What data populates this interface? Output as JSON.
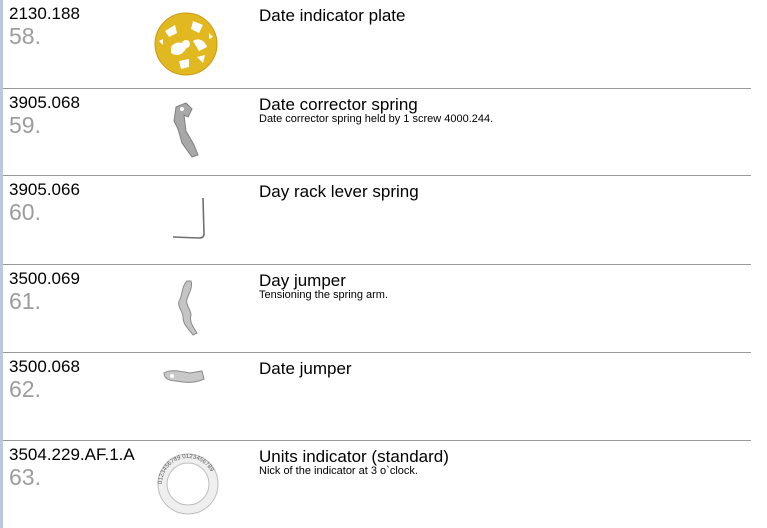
{
  "parts": [
    {
      "code": "2130.188",
      "number": "58.",
      "title": "Date indicator plate",
      "description": "",
      "image": "date-indicator-plate-image"
    },
    {
      "code": "3905.068",
      "number": "59.",
      "title": "Date corrector spring",
      "description": "Date corrector spring held by 1 screw 4000.244.",
      "image": "date-corrector-spring-image"
    },
    {
      "code": "3905.066",
      "number": "60.",
      "title": "Day rack lever spring",
      "description": "",
      "image": "day-rack-lever-spring-image"
    },
    {
      "code": "3500.069",
      "number": "61.",
      "title": "Day jumper",
      "description": "Tensioning the spring arm.",
      "image": "day-jumper-image"
    },
    {
      "code": "3500.068",
      "number": "62.",
      "title": "Date jumper",
      "description": "",
      "image": "date-jumper-image"
    },
    {
      "code": "3504.229.AF.1.A",
      "number": "63.",
      "title": "Units indicator (standard)",
      "description": "Nick of the indicator at 3 o`clock.",
      "image": "units-indicator-ring-image",
      "ring_text": "0123456789 0123456789"
    }
  ],
  "colors": {
    "left_bar": "#b9c8de",
    "number_gray": "#9c9c9c",
    "separator": "#9a9a9a",
    "gold": "#e2b820"
  }
}
